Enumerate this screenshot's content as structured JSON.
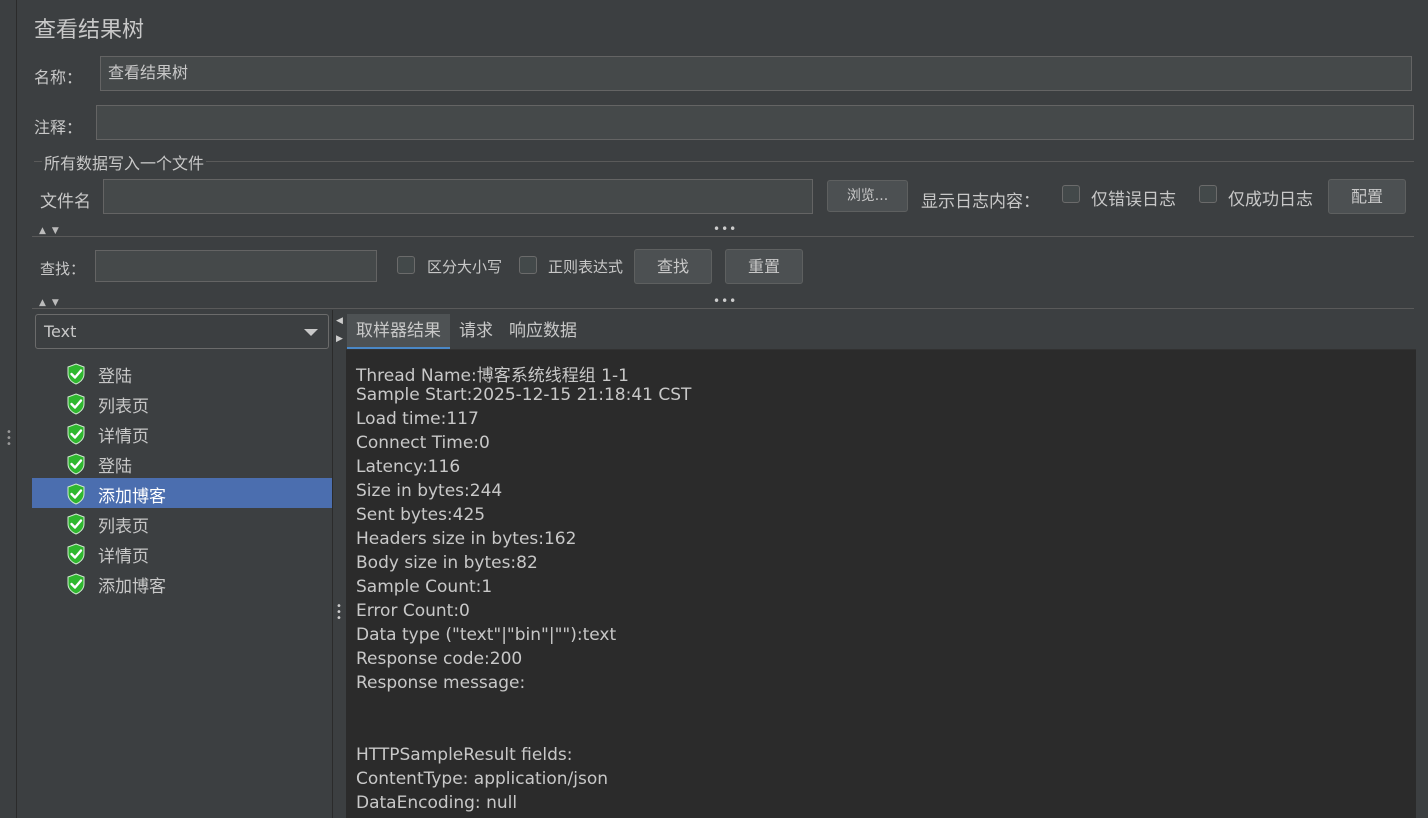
{
  "header": {
    "title": "查看结果树"
  },
  "form": {
    "name_label": "名称：",
    "name_value": "查看结果树",
    "comment_label": "注释：",
    "comment_value": ""
  },
  "file_group": {
    "title": "所有数据写入一个文件",
    "filename_label": "文件名",
    "filename_value": "",
    "browse_button": "浏览...",
    "log_content_label": "显示日志内容：",
    "errors_only_label": "仅错误日志",
    "success_only_label": "仅成功日志",
    "config_button": "配置"
  },
  "search": {
    "label": "查找：",
    "value": "",
    "case_sensitive_label": "区分大小写",
    "regex_label": "正则表达式",
    "find_button": "查找",
    "reset_button": "重置"
  },
  "renderer": {
    "selected": "Text"
  },
  "tree": {
    "items": [
      {
        "label": "登陆",
        "selected": false
      },
      {
        "label": "列表页",
        "selected": false
      },
      {
        "label": "详情页",
        "selected": false
      },
      {
        "label": "登陆",
        "selected": false
      },
      {
        "label": "添加博客",
        "selected": true
      },
      {
        "label": "列表页",
        "selected": false
      },
      {
        "label": "详情页",
        "selected": false
      },
      {
        "label": "添加博客",
        "selected": false
      }
    ]
  },
  "tabs": {
    "sampler_result": "取样器结果",
    "request": "请求",
    "response_data": "响应数据"
  },
  "result": {
    "lines": [
      "Thread Name:博客系统线程组 1-1",
      "Sample Start:2025-12-15 21:18:41 CST",
      "Load time:117",
      "Connect Time:0",
      "Latency:116",
      "Size in bytes:244",
      "Sent bytes:425",
      "Headers size in bytes:162",
      "Body size in bytes:82",
      "Sample Count:1",
      "Error Count:0",
      "Data type (\"text\"|\"bin\"|\"\"):text",
      "Response code:200",
      "Response message:",
      "",
      "",
      "HTTPSampleResult fields:",
      "ContentType: application/json",
      "DataEncoding: null"
    ]
  },
  "colors": {
    "background": "#3c3f41",
    "content_background": "#2b2b2b",
    "selection": "#4b6eaf",
    "success_icon": "#2fb82f"
  }
}
